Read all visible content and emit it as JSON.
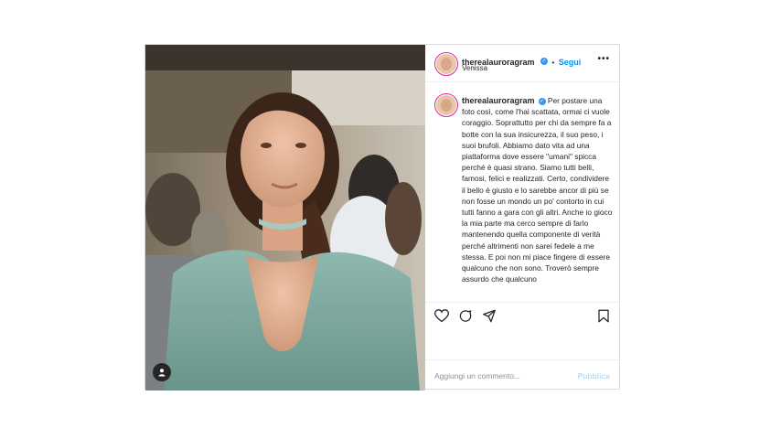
{
  "post": {
    "username": "therealauroragram",
    "verified_icon": "verified-badge-icon",
    "separator": "•",
    "follow_label": "Segui",
    "location": "Venissa",
    "more_icon": "more-options-icon",
    "more_glyph": "•••",
    "caption": {
      "username": "therealauroragram",
      "text": "Per postare una foto così, come l'hai scattata, ormai ci vuole coraggio. Soprattutto per chi da sempre fa a botte con la sua insicurezza, il suo peso, i suoi brufoli. Abbiamo dato vita ad una piattaforma dove essere \"umani\" spicca perché è quasi strano. Siamo tutti belli, famosi, felici e realizzati. Certo, condividere il bello è giusto e lo sarebbe ancor di più se non fosse un mondo un po' contorto in cui tutti fanno a gara con gli altri. Anche io gioco la mia parte ma cerco sempre di farlo mantenendo quella componente di verità perché altrimenti non sarei fedele a me stessa. E poi non mi piace fingere di essere qualcuno che non sono. Troverò sempre assurdo che qualcuno"
    },
    "actions": [
      "heart-icon",
      "comment-icon",
      "share-icon",
      "bookmark-icon"
    ],
    "comment": {
      "placeholder": "Aggiungi un commento...",
      "publish_label": "Pubblica"
    }
  }
}
